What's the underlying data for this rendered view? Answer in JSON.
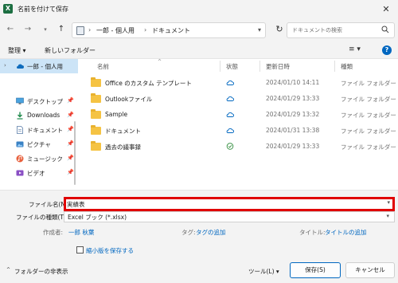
{
  "window": {
    "title": "名前を付けて保存",
    "app_icon_letter": "X",
    "close_glyph": "✕"
  },
  "nav": {
    "back": "←",
    "forward": "→",
    "history": "▾",
    "up": "↑",
    "breadcrumb": [
      "一郎 - 個人用",
      "ドキュメント"
    ],
    "separator": "›",
    "address_chevron": "▾",
    "refresh": "↻",
    "search_placeholder": "ドキュメントの検索"
  },
  "toolbar": {
    "organize": "整理 ▾",
    "new_folder": "新しいフォルダー",
    "view": "≡ ▾",
    "help": "?"
  },
  "sidebar": {
    "items": [
      {
        "label": "一郎 - 個人用",
        "icon": "cloud-icon",
        "expander": "›",
        "selected": true,
        "pinned": false
      },
      {
        "label": "デスクトップ",
        "icon": "desktop-icon",
        "expander": "",
        "selected": false,
        "pinned": true
      },
      {
        "label": "Downloads",
        "icon": "download-icon",
        "expander": "",
        "selected": false,
        "pinned": true
      },
      {
        "label": "ドキュメント",
        "icon": "document-icon",
        "expander": "",
        "selected": false,
        "pinned": true
      },
      {
        "label": "ピクチャ",
        "icon": "pictures-icon",
        "expander": "",
        "selected": false,
        "pinned": true
      },
      {
        "label": "ミュージック",
        "icon": "music-icon",
        "expander": "",
        "selected": false,
        "pinned": true
      },
      {
        "label": "ビデオ",
        "icon": "video-icon",
        "expander": "",
        "selected": false,
        "pinned": true
      }
    ],
    "pin_glyph": "📌"
  },
  "filelist": {
    "columns": {
      "name": "名前",
      "status": "状態",
      "date": "更新日時",
      "type": "種類"
    },
    "sort_arrow": "^",
    "rows": [
      {
        "name": "Office のカスタム テンプレート",
        "status": "cloud",
        "date": "2024/01/10 14:11",
        "type": "ファイル フォルダー"
      },
      {
        "name": "Outlookファイル",
        "status": "cloud",
        "date": "2024/01/29 13:33",
        "type": "ファイル フォルダー"
      },
      {
        "name": "Sample",
        "status": "cloud",
        "date": "2024/01/29 13:32",
        "type": "ファイル フォルダー"
      },
      {
        "name": "ドキュメント",
        "status": "cloud",
        "date": "2024/01/31 13:38",
        "type": "ファイル フォルダー"
      },
      {
        "name": "過去の議事録",
        "status": "synced",
        "date": "2024/01/29 13:33",
        "type": "ファイル フォルダー"
      }
    ],
    "colors": {
      "cloud": "#0067c0",
      "synced": "#2e8b3a"
    }
  },
  "form": {
    "file_name_label": "ファイル名(N):",
    "file_name_value": "実績表",
    "file_type_label": "ファイルの種類(T):",
    "file_type_value": "Excel ブック (*.xlsx)",
    "author_label": "作成者:",
    "author_value": "一郎 秋葉",
    "tags_label": "タグ:",
    "tags_value": "タグの追加",
    "title_label": "タイトル:",
    "title_value": "タイトルの追加",
    "thumbnail_label": "縮小版を保存する",
    "highlight_color": "#e00000"
  },
  "footer": {
    "hide_folders": "フォルダーの非表示",
    "hide_chevron": "^",
    "tools": "ツール(L) ▾",
    "save": "保存(S)",
    "cancel": "キャンセル"
  }
}
